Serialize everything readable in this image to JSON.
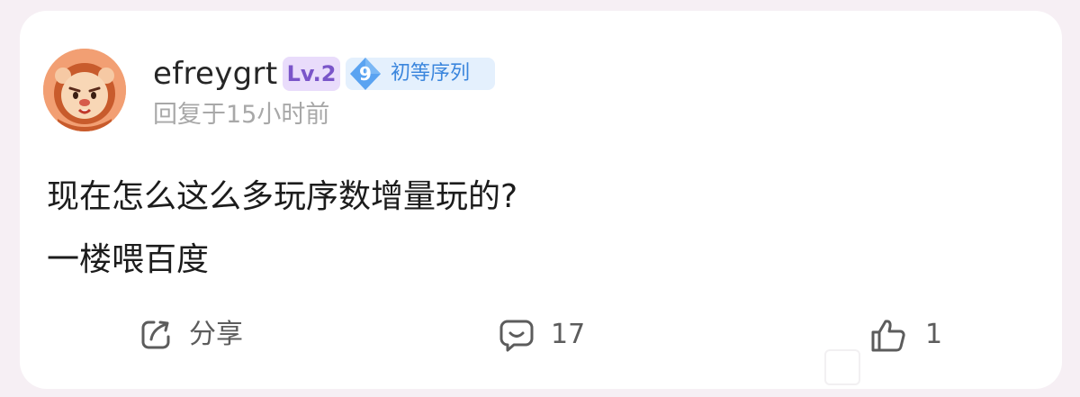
{
  "comment": {
    "avatar_icon": "lion-avatar-icon",
    "username": "efreygrt",
    "level_badge": "Lv.2",
    "rank_badge": {
      "number": "9",
      "title": "初等序列",
      "color": "#3b86dd"
    },
    "reply_time": "回复于15小时前",
    "text": "现在怎么这么多玩序数增量玩的?",
    "subtext": "一楼喂百度"
  },
  "actions": {
    "share": {
      "icon": "share-icon",
      "label": "分享"
    },
    "comment": {
      "icon": "comment-icon",
      "count": "17"
    },
    "like": {
      "icon": "thumbs-up-icon",
      "count": "1"
    }
  },
  "colors": {
    "background": "#f6eff4",
    "card": "#ffffff",
    "level_badge_bg": "#e9dcfb",
    "level_badge_text": "#7a55c9",
    "rank_badge_bg": "#e4f0fd"
  }
}
